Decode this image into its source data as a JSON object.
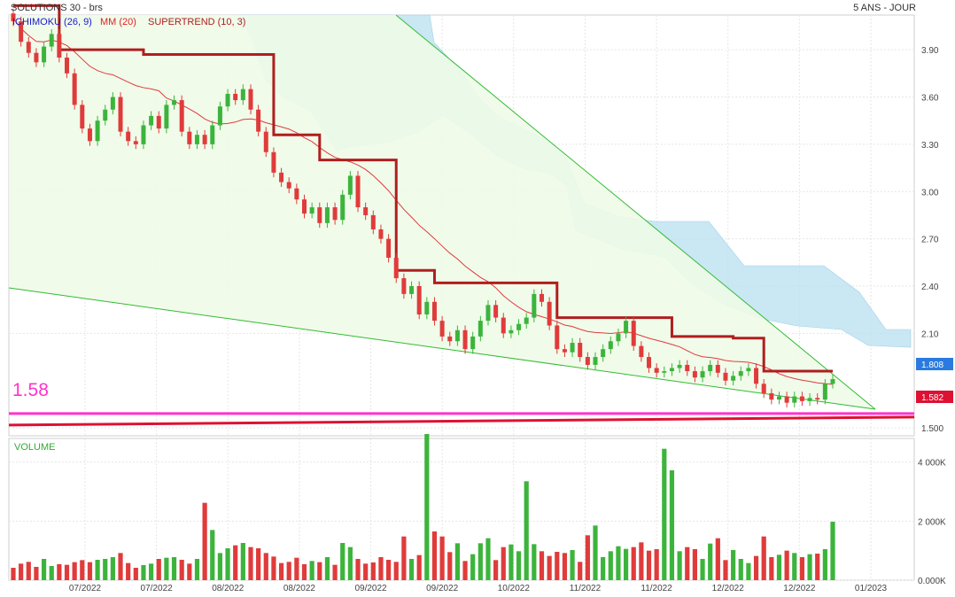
{
  "header": {
    "title": "SOLUTIONS 30 - brs",
    "period": "5 ANS - JOUR"
  },
  "legend": {
    "ichimoku": "ICHIMOKU (26, 9)",
    "mm": "MM (20)",
    "supertrend": "SUPERTREND (10, 3)"
  },
  "colors": {
    "up": "#3cb43c",
    "down": "#e03b3b",
    "mm": "#e03b3b",
    "supertrend": "#b01e1e",
    "cloud": "#b8dff0",
    "trend_lines": "#33bb33",
    "support_magenta": "#ff33cc",
    "support_red": "#dd1133",
    "ichimoku_label": "#1a1acc",
    "mm_label": "#dd2222",
    "supertrend_label": "#b01e1e",
    "volume_label": "#33aa33"
  },
  "price_badges": {
    "last": "1.808",
    "support": "1.582",
    "support_annotation": "1.58"
  },
  "volume_panel": {
    "label": "VOLUME"
  },
  "chart_data": [
    {
      "type": "candlestick",
      "title": "SOLUTIONS 30 - brs",
      "yticks": [
        "3.90",
        "3.60",
        "3.30",
        "3.00",
        "2.70",
        "2.40",
        "2.10",
        "1.500"
      ],
      "ylim": [
        1.45,
        4.12
      ],
      "xtick_labels": [
        "07/2022",
        "07/2022",
        "08/2022",
        "08/2022",
        "09/2022",
        "09/2022",
        "10/2022",
        "11/2022",
        "11/2022",
        "12/2022",
        "12/2022",
        "01/2023"
      ],
      "closes": [
        4.08,
        3.95,
        3.88,
        3.82,
        3.92,
        4.0,
        3.85,
        3.75,
        3.55,
        3.4,
        3.32,
        3.45,
        3.52,
        3.6,
        3.38,
        3.32,
        3.3,
        3.42,
        3.48,
        3.4,
        3.55,
        3.58,
        3.38,
        3.3,
        3.36,
        3.3,
        3.42,
        3.54,
        3.62,
        3.58,
        3.65,
        3.52,
        3.38,
        3.25,
        3.12,
        3.06,
        3.02,
        2.95,
        2.86,
        2.9,
        2.8,
        2.9,
        2.82,
        2.98,
        3.1,
        2.9,
        2.85,
        2.76,
        2.7,
        2.58,
        2.45,
        2.35,
        2.4,
        2.22,
        2.3,
        2.18,
        2.08,
        2.05,
        2.12,
        2.0,
        2.08,
        2.18,
        2.28,
        2.2,
        2.1,
        2.12,
        2.16,
        2.2,
        2.35,
        2.3,
        2.15,
        2.0,
        1.98,
        2.04,
        1.95,
        1.9,
        1.95,
        2.0,
        2.05,
        2.1,
        2.18,
        2.02,
        1.95,
        1.88,
        1.85,
        1.86,
        1.88,
        1.9,
        1.86,
        1.82,
        1.86,
        1.9,
        1.85,
        1.8,
        1.83,
        1.86,
        1.88,
        1.78,
        1.72,
        1.68,
        1.7,
        1.66,
        1.7,
        1.67,
        1.69,
        1.68,
        1.78,
        1.81
      ],
      "series": [
        {
          "name": "MM (20)",
          "kind": "line"
        },
        {
          "name": "SUPERTREND (10, 3)",
          "kind": "step-line"
        },
        {
          "name": "ICHIMOKU (26, 9)",
          "kind": "cloud"
        }
      ],
      "supertrend_levels": [
        {
          "from": 0,
          "to": 6,
          "value": 4.18
        },
        {
          "from": 6,
          "to": 11,
          "value": 3.9
        },
        {
          "from": 11,
          "to": 17,
          "value": 3.9
        },
        {
          "from": 17,
          "to": 23,
          "value": 3.87
        },
        {
          "from": 23,
          "to": 34,
          "value": 3.87
        },
        {
          "from": 34,
          "to": 40,
          "value": 3.36
        },
        {
          "from": 40,
          "to": 50,
          "value": 3.2
        },
        {
          "from": 50,
          "to": 55,
          "value": 2.5
        },
        {
          "from": 55,
          "to": 71,
          "value": 2.42
        },
        {
          "from": 71,
          "to": 86,
          "value": 2.2
        },
        {
          "from": 86,
          "to": 94,
          "value": 2.08
        },
        {
          "from": 94,
          "to": 98,
          "value": 2.07
        },
        {
          "from": 98,
          "to": 107,
          "value": 1.86
        }
      ],
      "support_level": 1.58,
      "last_price": 1.808
    },
    {
      "type": "bar",
      "title": "VOLUME",
      "yticks": [
        "4 000K",
        "2 000K",
        "0.000K"
      ],
      "ylim": [
        0,
        4800
      ],
      "values": [
        420,
        560,
        620,
        450,
        720,
        480,
        540,
        520,
        610,
        680,
        610,
        690,
        720,
        780,
        920,
        580,
        420,
        510,
        560,
        720,
        760,
        780,
        690,
        560,
        720,
        2620,
        1700,
        920,
        1080,
        1180,
        1260,
        1120,
        1080,
        920,
        800,
        580,
        620,
        760,
        540,
        650,
        610,
        780,
        520,
        1260,
        1120,
        720,
        560,
        600,
        780,
        690,
        620,
        1480,
        720,
        850,
        4950,
        1650,
        1480,
        950,
        1250,
        650,
        880,
        1250,
        1420,
        680,
        1120,
        1210,
        980,
        3350,
        1220,
        980,
        820,
        960,
        920,
        1020,
        620,
        1520,
        1850,
        780,
        980,
        1150,
        1060,
        1120,
        1280,
        1000,
        1050,
        4450,
        3720,
        980,
        1120,
        1050,
        720,
        1240,
        1420,
        680,
        1020,
        720,
        580,
        820,
        1480,
        780,
        860,
        1000,
        920,
        780,
        880,
        900,
        1050,
        1980
      ]
    }
  ]
}
